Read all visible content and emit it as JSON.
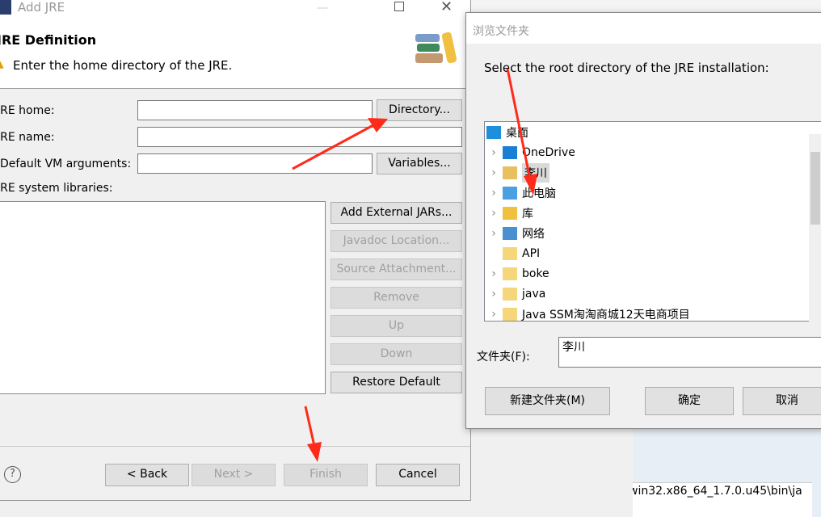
{
  "add_jre": {
    "title": "Add JRE",
    "header_title": "JRE Definition",
    "header_message": "Enter the home directory of the JRE.",
    "jre_home_label": "JRE home:",
    "jre_home_value": "",
    "directory_button": "Directory...",
    "jre_name_label": "JRE name:",
    "jre_name_value": "",
    "vm_args_label": "Default VM arguments:",
    "vm_args_value": "",
    "variables_button": "Variables...",
    "libraries_label": "JRE system libraries:",
    "side_buttons": [
      {
        "label": "Add External JARs...",
        "enabled": true
      },
      {
        "label": "Javadoc Location...",
        "enabled": false
      },
      {
        "label": "Source Attachment...",
        "enabled": false
      },
      {
        "label": "Remove",
        "enabled": false
      },
      {
        "label": "Up",
        "enabled": false
      },
      {
        "label": "Down",
        "enabled": false
      },
      {
        "label": "Restore Default",
        "enabled": true
      }
    ],
    "help_icon": "?",
    "back_button": "< Back",
    "next_button": "Next >",
    "finish_button": "Finish",
    "cancel_button": "Cancel"
  },
  "browse": {
    "title": "浏览文件夹",
    "prompt": "Select the root directory of the JRE installation:",
    "tree": [
      {
        "label": "桌面",
        "icon": "desktop-icon",
        "expandable": false,
        "indent": 0
      },
      {
        "label": "OneDrive",
        "icon": "cloud-icon",
        "expandable": true,
        "indent": 1
      },
      {
        "label": "李川",
        "icon": "user-folder-icon",
        "expandable": true,
        "indent": 1,
        "selected": true
      },
      {
        "label": "此电脑",
        "icon": "computer-icon",
        "expandable": true,
        "indent": 1
      },
      {
        "label": "库",
        "icon": "library-icon",
        "expandable": true,
        "indent": 1
      },
      {
        "label": "网络",
        "icon": "network-icon",
        "expandable": true,
        "indent": 1
      },
      {
        "label": "API",
        "icon": "folder-shortcut-icon",
        "expandable": false,
        "indent": 1
      },
      {
        "label": "boke",
        "icon": "folder-shortcut-icon",
        "expandable": true,
        "indent": 1
      },
      {
        "label": "java",
        "icon": "folder-shortcut-icon",
        "expandable": true,
        "indent": 1
      },
      {
        "label": "Java SSM淘淘商城12天电商项目",
        "icon": "folder-shortcut-icon",
        "expandable": true,
        "indent": 1
      }
    ],
    "folder_label": "文件夹(F):",
    "folder_value": "李川",
    "new_folder_button": "新建文件夹(M)",
    "ok_button": "确定",
    "cancel_button": "取消"
  },
  "background": {
    "console_path": "win32.x86_64_1.7.0.u45\\bin\\ja"
  },
  "colors": {
    "annotation_arrow": "#ff2a1a",
    "selection": "#d9d9d9"
  }
}
